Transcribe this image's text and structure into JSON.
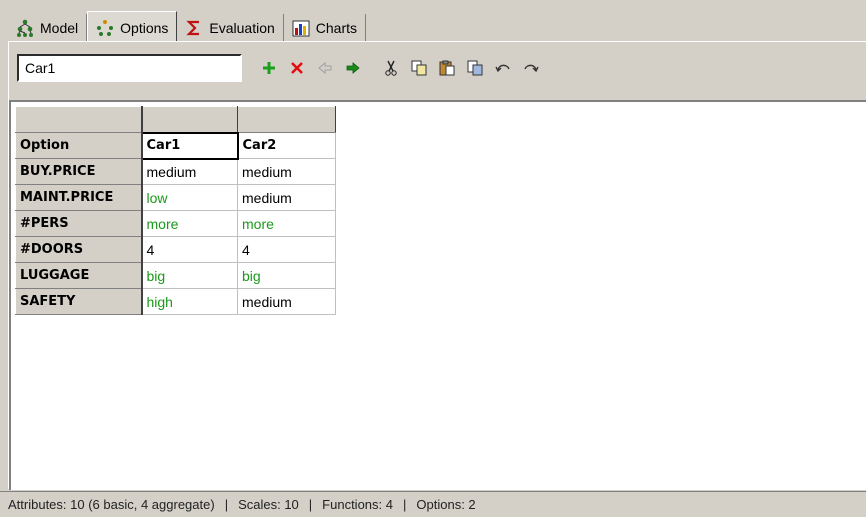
{
  "tabs": [
    {
      "label": "Model",
      "icon": "tree-icon",
      "active": false
    },
    {
      "label": "Options",
      "icon": "dots-icon",
      "active": true
    },
    {
      "label": "Evaluation",
      "icon": "sigma-icon",
      "active": false
    },
    {
      "label": "Charts",
      "icon": "chart-icon",
      "active": false
    }
  ],
  "toolbar": {
    "name_value": "Car1",
    "buttons": [
      "add-icon",
      "delete-icon",
      "move-left-icon",
      "move-right-icon",
      "cut-icon",
      "copy-icon",
      "paste-icon",
      "paste-special-icon",
      "undo-icon",
      "redo-icon"
    ]
  },
  "grid": {
    "header_label": "Option",
    "columns": [
      "Car1",
      "Car2"
    ],
    "rows": [
      {
        "label": "BUY.PRICE",
        "values": [
          "medium",
          "medium"
        ],
        "highlight": [
          false,
          false
        ]
      },
      {
        "label": "MAINT.PRICE",
        "values": [
          "low",
          "medium"
        ],
        "highlight": [
          true,
          false
        ]
      },
      {
        "label": "#PERS",
        "values": [
          "more",
          "more"
        ],
        "highlight": [
          true,
          true
        ]
      },
      {
        "label": "#DOORS",
        "values": [
          "4",
          "4"
        ],
        "highlight": [
          false,
          false
        ]
      },
      {
        "label": "LUGGAGE",
        "values": [
          "big",
          "big"
        ],
        "highlight": [
          true,
          true
        ]
      },
      {
        "label": "SAFETY",
        "values": [
          "high",
          "medium"
        ],
        "highlight": [
          true,
          false
        ]
      }
    ]
  },
  "status": {
    "attributes": "Attributes: 10 (6 basic, 4 aggregate)",
    "scales": "Scales: 10",
    "functions": "Functions: 4",
    "options": "Options: 2",
    "sep": "|"
  },
  "colors": {
    "highlight_text": "#1a9a1a",
    "face": "#d4d0c8"
  }
}
